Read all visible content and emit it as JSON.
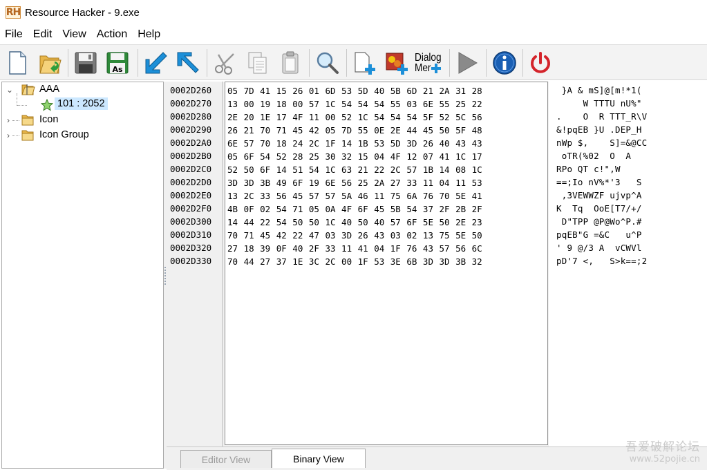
{
  "window": {
    "title": "Resource Hacker - 9.exe",
    "logo_text": "RH"
  },
  "menu": [
    "File",
    "Edit",
    "View",
    "Action",
    "Help"
  ],
  "toolbar": {
    "buttons": [
      {
        "name": "new-file",
        "icon": "new-document-icon"
      },
      {
        "name": "open-file",
        "icon": "open-folder-icon"
      },
      {
        "name": "save",
        "icon": "floppy-save-icon"
      },
      {
        "name": "save-as",
        "icon": "floppy-save-as-icon",
        "label": "As"
      },
      {
        "name": "compile",
        "icon": "arrow-down-left-icon"
      },
      {
        "name": "go-to",
        "icon": "arrow-up-left-icon"
      },
      {
        "name": "cut",
        "icon": "scissors-icon"
      },
      {
        "name": "copy",
        "icon": "copy-icon"
      },
      {
        "name": "paste",
        "icon": "paste-icon"
      },
      {
        "name": "find",
        "icon": "magnifier-icon"
      },
      {
        "name": "add-blank",
        "icon": "add-blank-resource-icon"
      },
      {
        "name": "add-image",
        "icon": "add-image-resource-icon"
      },
      {
        "name": "dialog-menu",
        "icon": "dialog-menu-icon",
        "label_line1": "Dialog",
        "label_line2": "Mer"
      },
      {
        "name": "run",
        "icon": "play-icon"
      },
      {
        "name": "about",
        "icon": "info-icon"
      },
      {
        "name": "exit",
        "icon": "power-icon"
      }
    ]
  },
  "tree": {
    "nodes": [
      {
        "label": "AAA",
        "expanded": true,
        "level": 0,
        "icon": "folder-open-icon"
      },
      {
        "label": "101 : 2052",
        "level": 1,
        "icon": "star-icon",
        "selected": true
      },
      {
        "label": "Icon",
        "expanded": false,
        "level": 0,
        "icon": "folder-icon"
      },
      {
        "label": "Icon Group",
        "expanded": false,
        "level": 0,
        "icon": "folder-icon"
      }
    ]
  },
  "hex": {
    "rows": [
      {
        "addr": "0002D260",
        "bytes": "05 7D 41 15 26 01 6D 53 5D 40 5B 6D 21 2A 31 28",
        "ascii": " }A & mS]@[m!*1("
      },
      {
        "addr": "0002D270",
        "bytes": "13 00 19 18 00 57 1C 54 54 54 55 03 6E 55 25 22",
        "ascii": "     W TTTU nU%\""
      },
      {
        "addr": "0002D280",
        "bytes": "2E 20 1E 17 4F 11 00 52 1C 54 54 54 5F 52 5C 56",
        "ascii": ".    O  R TTT_R\\V"
      },
      {
        "addr": "0002D290",
        "bytes": "26 21 70 71 45 42 05 7D 55 0E 2E 44 45 50 5F 48",
        "ascii": "&!pqEB }U .DEP_H"
      },
      {
        "addr": "0002D2A0",
        "bytes": "6E 57 70 18 24 2C 1F 14 1B 53 5D 3D 26 40 43 43",
        "ascii": "nWp $,    S]=&@CC"
      },
      {
        "addr": "0002D2B0",
        "bytes": "05 6F 54 52 28 25 30 32 15 04 4F 12 07 41 1C 17",
        "ascii": " oTR(%02  O  A"
      },
      {
        "addr": "0002D2C0",
        "bytes": "52 50 6F 14 51 54 1C 63 21 22 2C 57 1B 14 08 1C",
        "ascii": "RPo QT c!\",W"
      },
      {
        "addr": "0002D2D0",
        "bytes": "3D 3D 3B 49 6F 19 6E 56 25 2A 27 33 11 04 11 53",
        "ascii": "==;Io nV%*'3   S"
      },
      {
        "addr": "0002D2E0",
        "bytes": "13 2C 33 56 45 57 57 5A 46 11 75 6A 76 70 5E 41",
        "ascii": " ,3VEWWZF ujvp^A"
      },
      {
        "addr": "0002D2F0",
        "bytes": "4B 0F 02 54 71 05 0A 4F 6F 45 5B 54 37 2F 2B 2F",
        "ascii": "K  Tq  OoE[T7/+/"
      },
      {
        "addr": "0002D300",
        "bytes": "14 44 22 54 50 50 1C 40 50 40 57 6F 5E 50 2E 23",
        "ascii": " D\"TPP @P@Wo^P.#"
      },
      {
        "addr": "0002D310",
        "bytes": "70 71 45 42 22 47 03 3D 26 43 03 02 13 75 5E 50",
        "ascii": "pqEB\"G =&C   u^P"
      },
      {
        "addr": "0002D320",
        "bytes": "27 18 39 0F 40 2F 33 11 41 04 1F 76 43 57 56 6C",
        "ascii": "' 9 @/3 A  vCWVl"
      },
      {
        "addr": "0002D330",
        "bytes": "70 44 27 37 1E 3C 2C 00 1F 53 3E 6B 3D 3D 3B 32",
        "ascii": "pD'7 <,   S>k==;2"
      }
    ]
  },
  "tabs": [
    {
      "label": "Editor View",
      "active": false
    },
    {
      "label": "Binary View",
      "active": true
    }
  ],
  "watermark": {
    "line1": "吾爱破解论坛",
    "line2": "www.52pojie.cn"
  },
  "colors": {
    "selection": "#cce8ff",
    "toolbar_bg": "#f3f3f3",
    "exit_red": "#d4242b",
    "info_blue": "#1a5fb4",
    "arrow_blue": "#1c8fd8"
  }
}
